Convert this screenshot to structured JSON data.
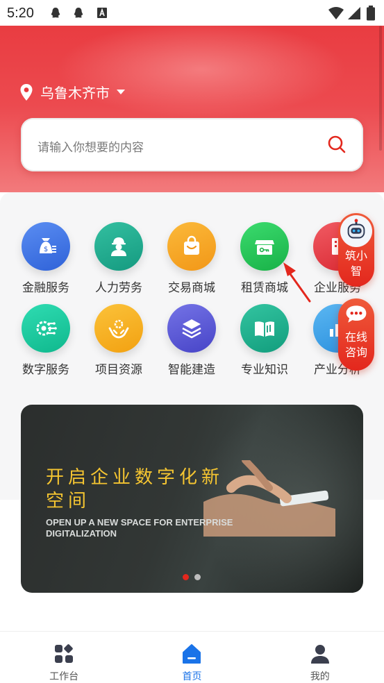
{
  "status_bar": {
    "time": "5:20"
  },
  "location": {
    "city": "乌鲁木齐市"
  },
  "search": {
    "placeholder": "请输入你想要的内容"
  },
  "services": [
    {
      "label": "金融服务",
      "icon": "money-bag-icon",
      "color": "#3f74e8"
    },
    {
      "label": "人力劳务",
      "icon": "worker-icon",
      "color": "#1ea58a"
    },
    {
      "label": "交易商城",
      "icon": "shopping-bag-icon",
      "color": "#f5a524"
    },
    {
      "label": "租赁商城",
      "icon": "store-icon",
      "color": "#23c455"
    },
    {
      "label": "企业服务",
      "icon": "building-icon",
      "color": "#e8434d"
    },
    {
      "label": "数字服务",
      "icon": "digital-icon",
      "color": "#14c69b"
    },
    {
      "label": "项目资源",
      "icon": "hands-gear-icon",
      "color": "#f5ad1f"
    },
    {
      "label": "智能建造",
      "icon": "layers-icon",
      "color": "#5a58d6"
    },
    {
      "label": "专业知识",
      "icon": "book-icon",
      "color": "#1db38e"
    },
    {
      "label": "产业分析",
      "icon": "chart-icon",
      "color": "#3aa2e8"
    }
  ],
  "floating": {
    "assistant_label": "筑小智",
    "consult_label": "在线咨询"
  },
  "banner": {
    "title_cn": "开启企业数字化新空间",
    "title_en": "OPEN UP A NEW SPACE FOR ENTERPRISE DIGITALIZATION",
    "slides": 2,
    "active_slide": 1
  },
  "nav": {
    "items": [
      {
        "label": "工作台",
        "icon": "workbench-icon"
      },
      {
        "label": "首页",
        "icon": "home-icon",
        "active": true
      },
      {
        "label": "我的",
        "icon": "profile-icon"
      }
    ]
  },
  "colors": {
    "brand_red": "#e8383d",
    "active_blue": "#1a73e8",
    "banner_gold": "#f5c531"
  }
}
